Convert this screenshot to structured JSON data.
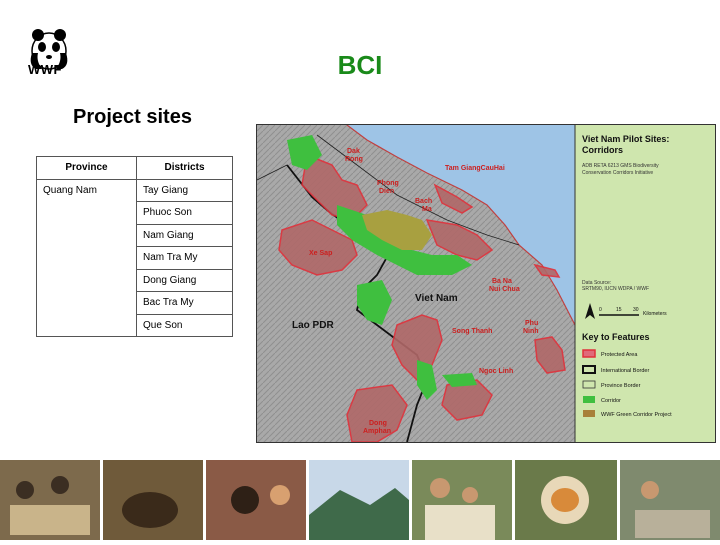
{
  "logo": {
    "text": "WWF"
  },
  "slide": {
    "title": "BCI",
    "subtitle": "Project sites"
  },
  "table": {
    "headers": [
      "Province",
      "Districts"
    ],
    "province": "Quang Nam",
    "districts": [
      "Tay Giang",
      "Phuoc Son",
      "Nam Giang",
      "Nam Tra My",
      "Dong Giang",
      "Bac Tra My",
      "Que Son"
    ]
  },
  "map": {
    "title": "Viet Nam Pilot Sites: Corridors",
    "initiative": "ADB RETA 6213 GMS Biodiversity Conservation Corridors Initiative",
    "data_source_label": "Data Source:",
    "data_source": "SRTM90, IUCN WDPA / WWF",
    "scale": {
      "ticks": [
        "0",
        "15",
        "30"
      ],
      "unit": "Kilometers"
    },
    "legend_title": "Key to Features",
    "legend": [
      "Protected Area",
      "International Border",
      "Province Border",
      "Corridor",
      "WWF Green Corridor Project"
    ],
    "places": {
      "dak_rong_1": "Dak",
      "dak_rong_2": "Rong",
      "tam_giang": "Tam GiangCauHai",
      "phong_dien_1": "Phong",
      "phong_dien_2": "Dien",
      "bach_ma_1": "Bach",
      "bach_ma_2": "Ma",
      "xe_sap": "Xe Sap",
      "ba_na_1": "Ba Na",
      "ba_na_2": "Nui Chua",
      "viet_nam": "Viet Nam",
      "lao_pdr": "Lao PDR",
      "song_thanh": "Song Thanh",
      "phu_ninh_1": "Phu",
      "phu_ninh_2": "Ninh",
      "ngoc_linh": "Ngoc Linh",
      "dong_amphan_1": "Dong",
      "dong_amphan_2": "Amphan"
    },
    "colors": {
      "sea": "#9ec4e6",
      "legend_bg": "#cfe6ae",
      "protected_area": "#b06868",
      "protected_border": "#e0303a",
      "corridor": "#3fbf3f",
      "wwf_project": "#a8a040",
      "terrain": "#a8a8a8"
    }
  },
  "photos": [
    {
      "name": "community-meeting-photo",
      "color": "#7d6a4c"
    },
    {
      "name": "saola-photo",
      "color": "#6f5a3a"
    },
    {
      "name": "weaving-photo",
      "color": "#8a5a46"
    },
    {
      "name": "mountain-forest-photo",
      "color": "#5d7f6a"
    },
    {
      "name": "family-photo",
      "color": "#7a8a5a"
    },
    {
      "name": "douc-langur-photo",
      "color": "#a86a3a"
    },
    {
      "name": "fieldwork-photo",
      "color": "#7f8a6e"
    }
  ]
}
